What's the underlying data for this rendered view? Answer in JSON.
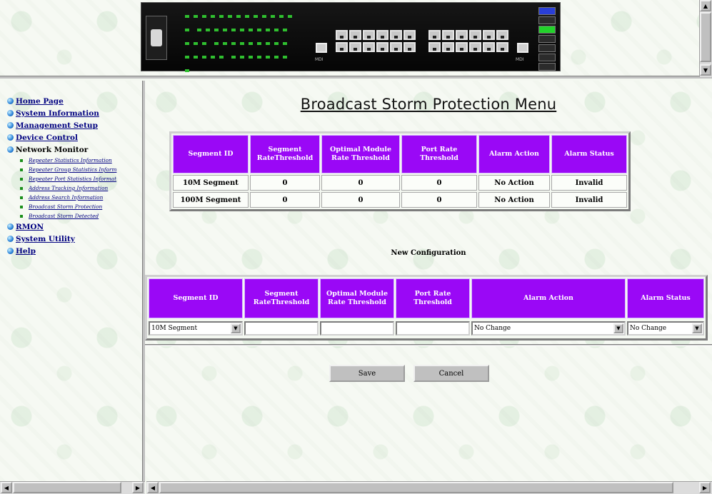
{
  "switch_panel": {
    "mdi_label": "MDI",
    "mdix_label": "MDI-X"
  },
  "nav": {
    "items": [
      {
        "label": "Home Page"
      },
      {
        "label": "System Information"
      },
      {
        "label": "Management Setup"
      },
      {
        "label": "Device Control"
      },
      {
        "label": "Network Monitor"
      }
    ],
    "sub_items": [
      {
        "label": "Repeater Statistics Information"
      },
      {
        "label": "Repeater Group Statistics Inform"
      },
      {
        "label": "Repeater Port Statistics Informat"
      },
      {
        "label": "Address Tracking Information"
      },
      {
        "label": "Address Search Information"
      },
      {
        "label": "Broadcast Storm Protection"
      },
      {
        "label": "Broadcast Storm Detected"
      }
    ],
    "bottom_items": [
      {
        "label": "RMON"
      },
      {
        "label": "System Utility"
      },
      {
        "label": "Help"
      }
    ]
  },
  "main": {
    "title": "Broadcast Storm Protection Menu",
    "status_table": {
      "headers": [
        "Segment ID",
        "Segment RateThreshold",
        "Optimal Module Rate Threshold",
        "Port Rate Threshold",
        "Alarm Action",
        "Alarm Status"
      ],
      "rows": [
        [
          "10M Segment",
          "0",
          "0",
          "0",
          "No Action",
          "Invalid"
        ],
        [
          "100M Segment",
          "0",
          "0",
          "0",
          "No Action",
          "Invalid"
        ]
      ]
    },
    "new_config_label": "New Configuration",
    "config_table": {
      "headers": [
        "Segment ID",
        "Segment RateThreshold",
        "Optimal Module Rate Threshold",
        "Port Rate Threshold",
        "Alarm Action",
        "Alarm Status"
      ],
      "segment_select": "10M Segment",
      "alarm_action_select": "No Change",
      "alarm_status_select": "No Change"
    },
    "buttons": {
      "save": "Save",
      "cancel": "Cancel"
    }
  },
  "colors": {
    "header_purple": "#9a08f6",
    "link_blue": "#000080"
  }
}
